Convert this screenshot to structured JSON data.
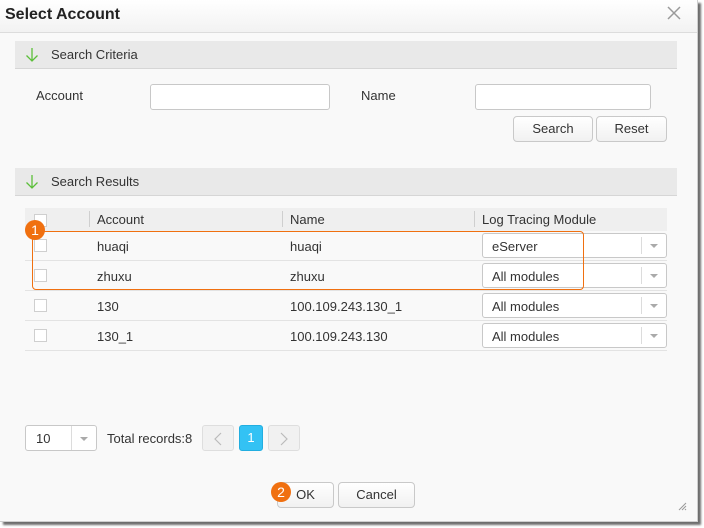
{
  "dialog": {
    "title": "Select Account",
    "close_icon": "close-icon"
  },
  "search_criteria": {
    "section_title": "Search Criteria",
    "account_label": "Account",
    "account_value": "",
    "name_label": "Name",
    "name_value": "",
    "search_button": "Search",
    "reset_button": "Reset"
  },
  "search_results": {
    "section_title": "Search Results",
    "columns": [
      "Account",
      "Name",
      "Log Tracing Module"
    ],
    "rows": [
      {
        "account": "huaqi",
        "name": "huaqi",
        "module": "eServer",
        "checked": false
      },
      {
        "account": "zhuxu",
        "name": "zhuxu",
        "module": "All modules",
        "checked": false
      },
      {
        "account": "130",
        "name": "100.109.243.130_1",
        "module": "All modules",
        "checked": false
      },
      {
        "account": "130_1",
        "name": "100.109.243.130",
        "module": "All modules",
        "checked": false
      }
    ]
  },
  "pagination": {
    "page_size": "10",
    "total_records": "Total records:8",
    "current_page": "1"
  },
  "footer": {
    "ok_button": "OK",
    "cancel_button": "Cancel"
  },
  "annotations": {
    "step1": "1",
    "step2": "2",
    "color": "#f07010"
  }
}
